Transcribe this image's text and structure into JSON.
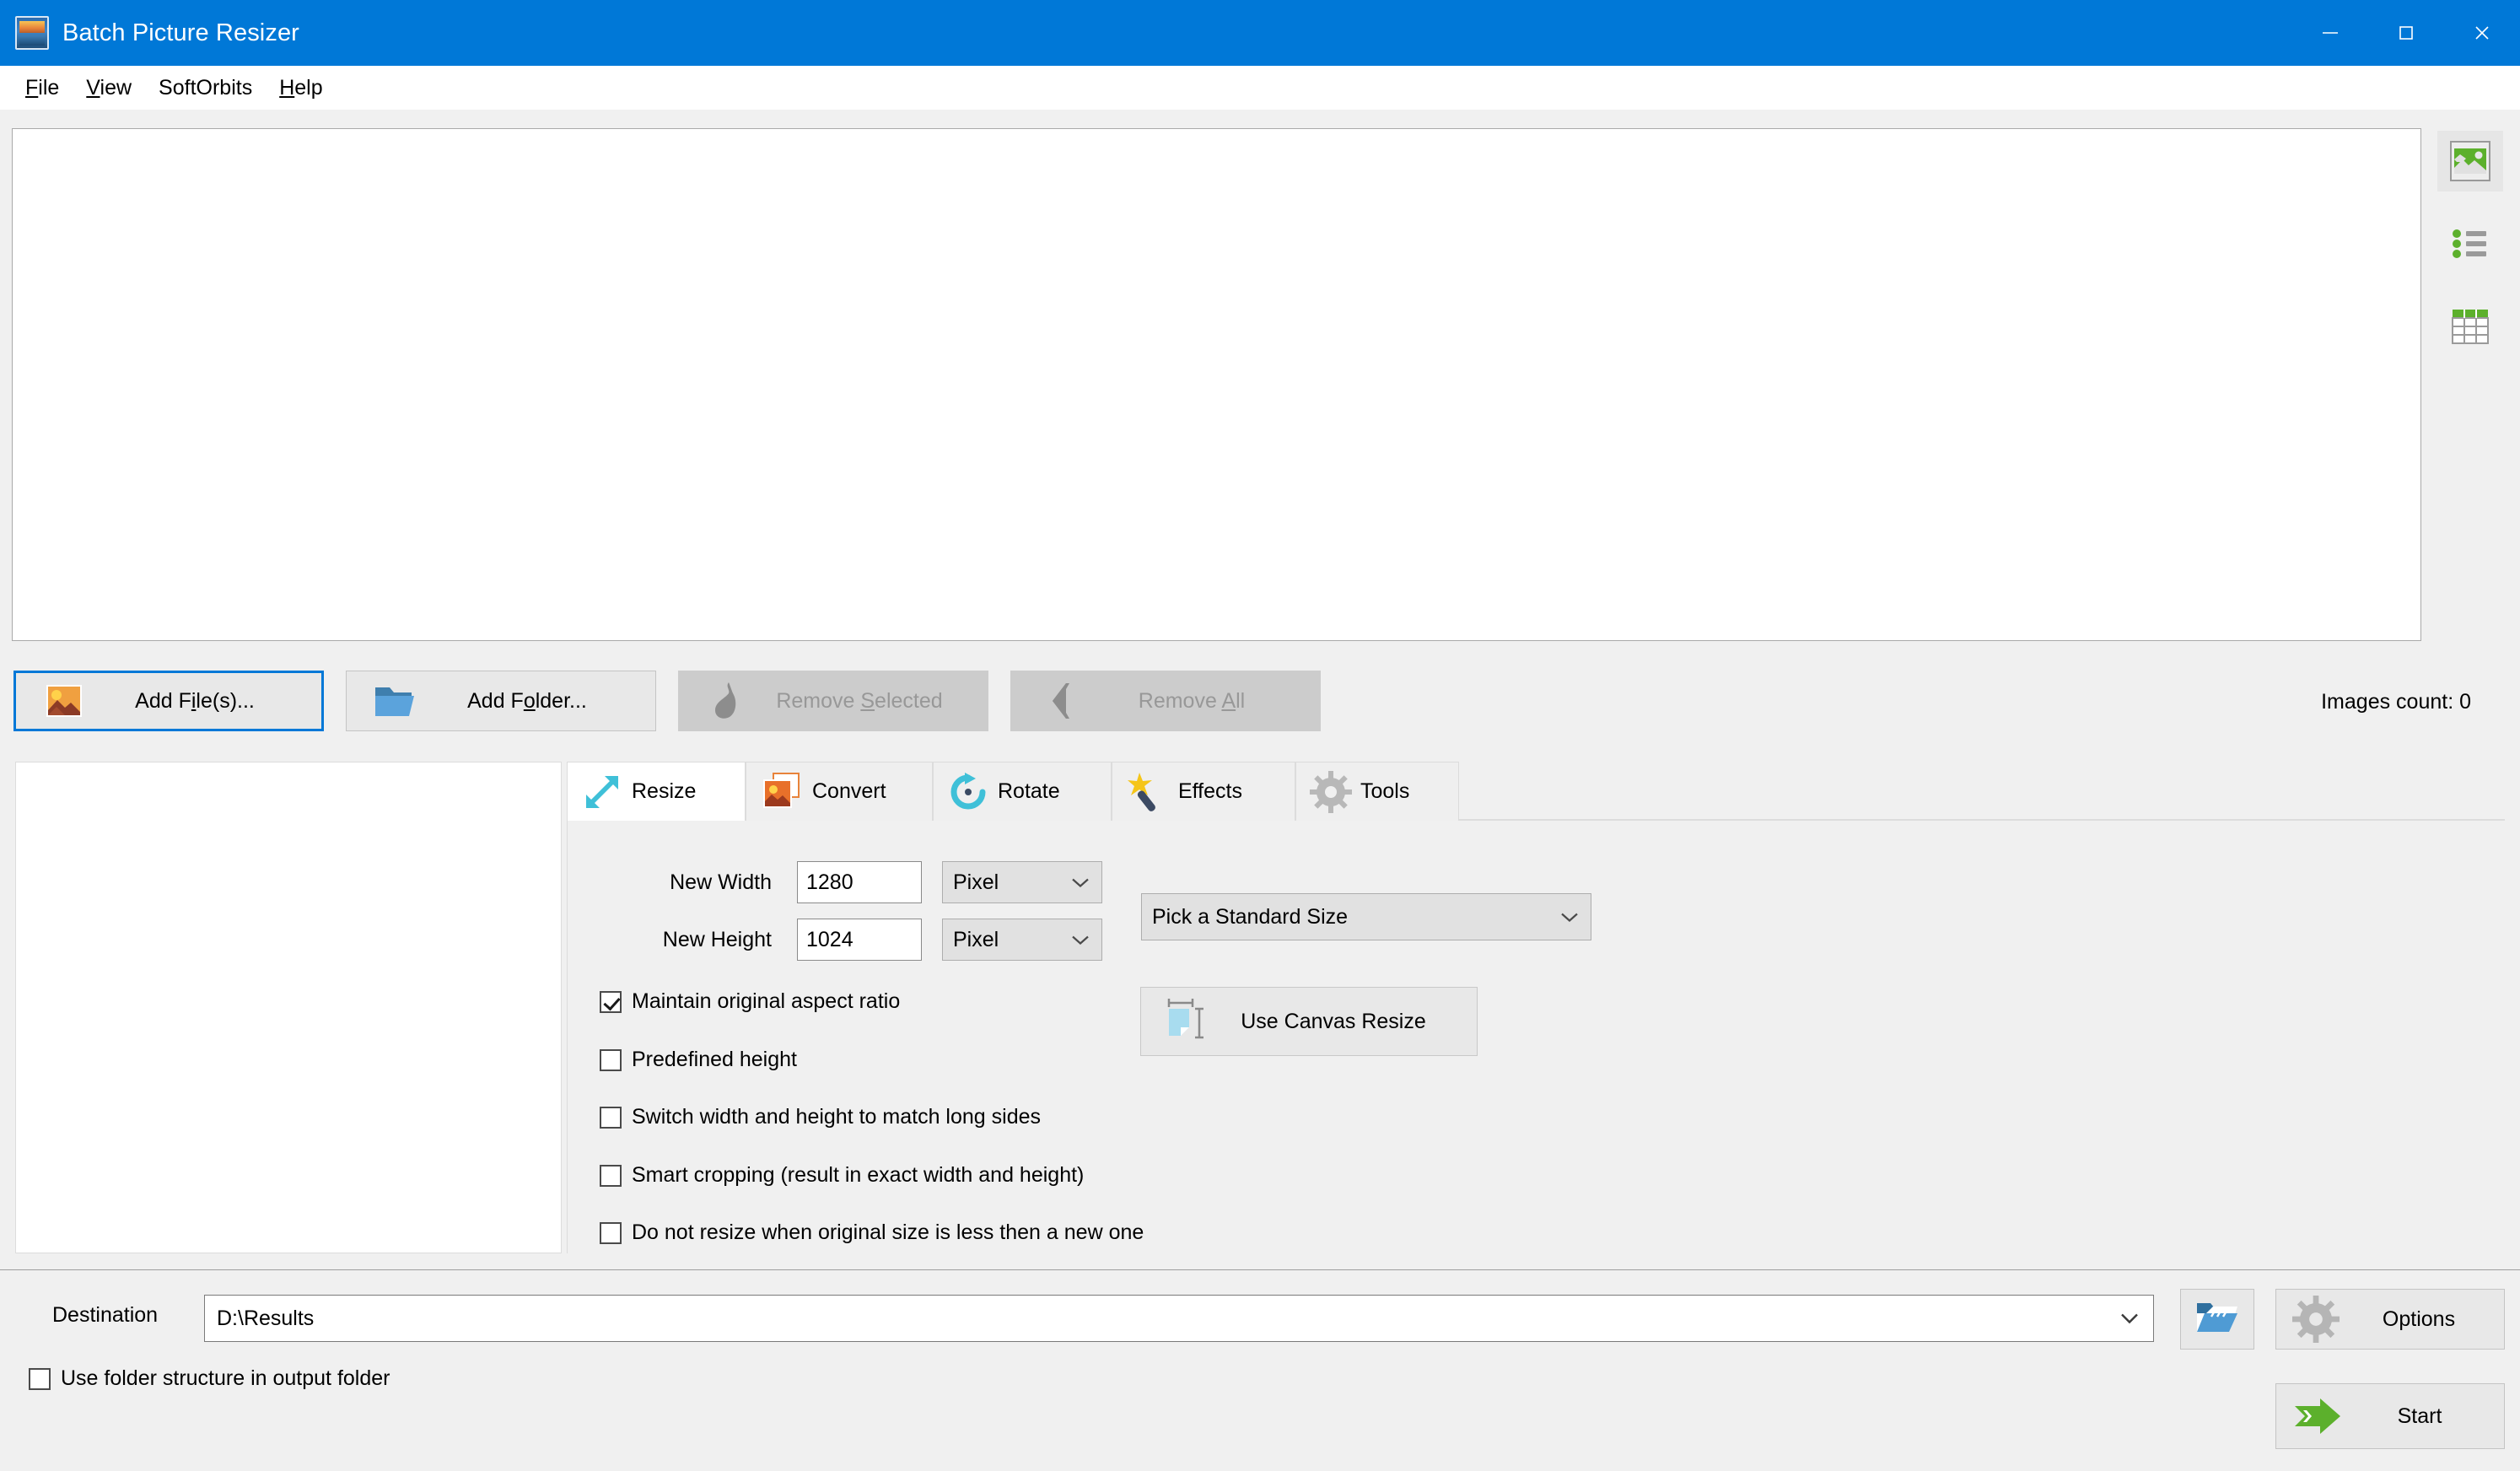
{
  "window": {
    "title": "Batch Picture Resizer",
    "app_icon": "picture-icon",
    "controls": {
      "minimize": "minimize-icon",
      "maximize": "maximize-icon",
      "close": "close-icon"
    }
  },
  "menu": {
    "items": [
      {
        "label": "File",
        "accel": "F"
      },
      {
        "label": "View",
        "accel": "V"
      },
      {
        "label": "SoftOrbits",
        "accel": ""
      },
      {
        "label": "Help",
        "accel": "H"
      }
    ]
  },
  "view_modes": [
    {
      "name": "thumbnail-view",
      "selected": true
    },
    {
      "name": "list-view",
      "selected": false
    },
    {
      "name": "details-view",
      "selected": false
    }
  ],
  "toolbar": {
    "buttons": [
      {
        "label_before": "Add F",
        "accel": "i",
        "label_after": "le(s)...",
        "full": "Add File(s)...",
        "icon": "image-icon",
        "disabled": false,
        "focused": true
      },
      {
        "label_before": "Add F",
        "accel": "o",
        "label_after": "lder...",
        "full": "Add Folder...",
        "icon": "folder-icon",
        "disabled": false,
        "focused": false
      },
      {
        "label_before": "Remove ",
        "accel": "S",
        "label_after": "elected",
        "full": "Remove Selected",
        "icon": "eraser-icon",
        "disabled": true,
        "focused": false
      },
      {
        "label_before": "Remove ",
        "accel": "A",
        "label_after": "ll",
        "full": "Remove All",
        "icon": "back-arrow-icon",
        "disabled": true,
        "focused": false
      }
    ],
    "images_count_label": "Images count: 0"
  },
  "tabs": [
    {
      "label": "Resize",
      "icon": "resize-arrow-icon",
      "active": true
    },
    {
      "label": "Convert",
      "icon": "convert-image-icon",
      "active": false
    },
    {
      "label": "Rotate",
      "icon": "rotate-icon",
      "active": false
    },
    {
      "label": "Effects",
      "icon": "magic-wand-icon",
      "active": false
    },
    {
      "label": "Tools",
      "icon": "gear-icon",
      "active": false
    }
  ],
  "resize": {
    "new_width_label": "New Width",
    "new_width_value": "1280",
    "new_width_unit": "Pixel",
    "new_height_label": "New Height",
    "new_height_value": "1024",
    "new_height_unit": "Pixel",
    "standard_size_value": "Pick a Standard Size",
    "canvas_resize_label": "Use Canvas Resize",
    "checkboxes": [
      {
        "label": "Maintain original aspect ratio",
        "checked": true
      },
      {
        "label": "Predefined height",
        "checked": false
      },
      {
        "label": "Switch width and height to match long sides",
        "checked": false
      },
      {
        "label": "Smart cropping (result in exact width and height)",
        "checked": false
      },
      {
        "label": "Do not resize when original size is less then a new one",
        "checked": false
      }
    ]
  },
  "footer": {
    "destination_label": "Destination",
    "destination_value": "D:\\Results",
    "browse_icon": "open-folder-icon",
    "options_label": "Options",
    "options_icon": "gear-icon",
    "start_label": "Start",
    "start_icon": "green-arrow-icon",
    "folder_structure_label": "Use folder structure in output folder",
    "folder_structure_checked": false
  },
  "colors": {
    "titlebar": "#0078d7",
    "accent": "#0078d7",
    "panel": "#f0f0f0",
    "green": "#5cb02c",
    "cyan": "#3fc0d8",
    "orange": "#e8833a"
  }
}
